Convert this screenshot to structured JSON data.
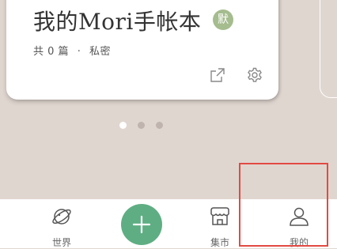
{
  "notebook_card": {
    "title": "我的Mori手帐本",
    "badge_label": "默",
    "meta_count_label": "共 0 篇",
    "meta_separator": "·",
    "meta_privacy_label": "私密",
    "icons": [
      "share-icon",
      "settings-icon"
    ]
  },
  "pager": {
    "pages": 3,
    "active": 0
  },
  "tabbar": {
    "world_label": "世界",
    "add_icon": "plus-icon",
    "market_label": "集市",
    "mine_label": "我的"
  },
  "colors": {
    "background": "#e0d6d0",
    "badge": "#a5bc8e",
    "add_button": "#5fae83",
    "highlight": "#e24a43"
  }
}
